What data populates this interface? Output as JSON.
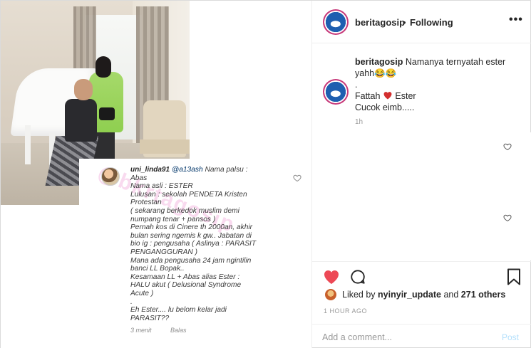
{
  "header": {
    "username": "beritagosip",
    "separator": "•",
    "follow_status": "Following",
    "more_icon": "•••"
  },
  "caption": {
    "username": "beritagosip",
    "line1": "Namanya ternyatah ester",
    "line2": "yahh😂😂",
    "line3": ".",
    "line4a": "Fattah",
    "line4b": "Ester",
    "line5": "Cucok eimb.....",
    "time": "1h"
  },
  "comment_shot": {
    "username": "uni_linda91",
    "mention": "@a13ash",
    "first_line_rest": "Nama palsu :",
    "text": "Abas\nNama asli : ESTER\nLulusan : sekolah PENDETA Kristen\nProtestan\n( sekarang berkedok muslim demi\nnumpang tenar + pansos )\nPernah kos di Cinere th 2000an, akhir\nbulan sering ngemis k gw.. Jabatan di\nbio ig : pengusaha ( Aslinya : PARASIT\nPENGANGGURAN )\nMana ada pengusaha 24 jam ngintilin\nbanci LL Bopak..\nKesamaan LL + Abas alias Ester :\nHALU akut ( Delusional Syndrome\nAcute )\n.\nEh Ester.... lu belom kelar jadi\nPARASIT??",
    "time": "3 menit",
    "reply": "Balas",
    "watermark": "@bkrtagosip"
  },
  "likes": {
    "liked_by_prefix": "Liked by",
    "liked_by_user": "nyinyir_update",
    "and": "and",
    "others": "271 others"
  },
  "time_ago": "1 HOUR AGO",
  "add_comment": {
    "placeholder": "Add a comment...",
    "post_label": "Post"
  },
  "colors": {
    "like_red": "#ed4956",
    "text": "#262626",
    "muted": "#999999",
    "post_disabled": "#b2dffc"
  },
  "icons": [
    "heart-icon",
    "comment-icon",
    "bookmark-icon",
    "more-icon",
    "red-heart-emoji",
    "small-heart-icon"
  ]
}
